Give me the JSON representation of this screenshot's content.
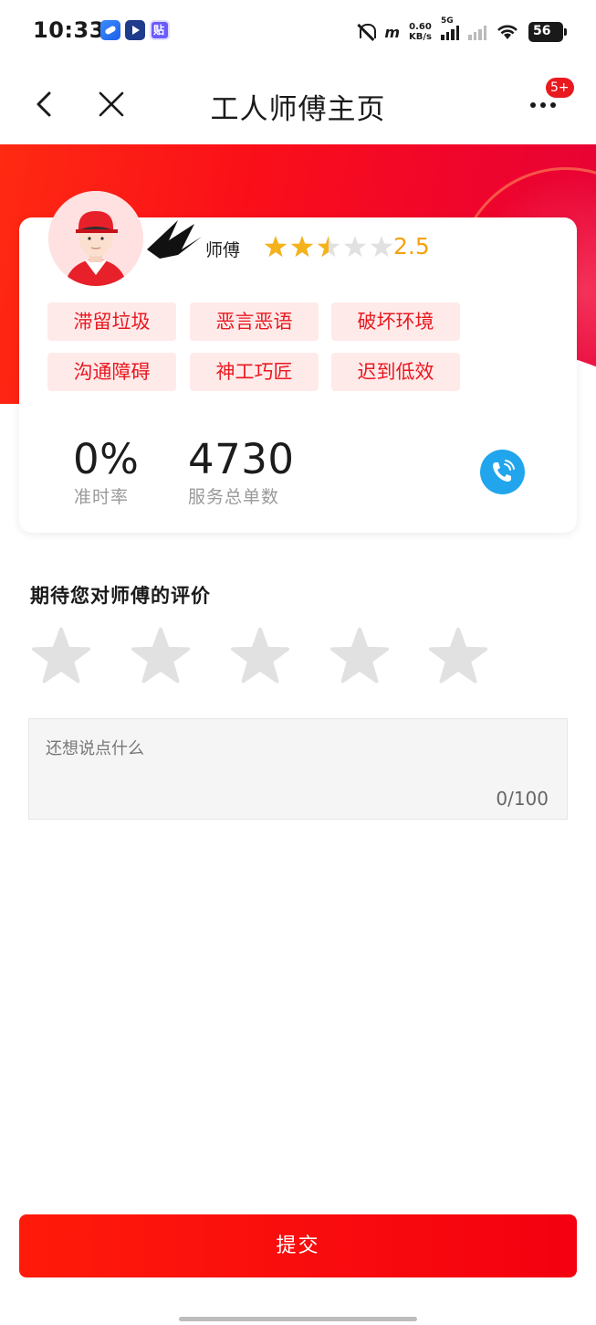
{
  "status_bar": {
    "time": "10:33",
    "app_icons": [
      "blue-app-icon",
      "video-app-icon",
      "sticker-app-icon"
    ],
    "app_icon_text": "贴",
    "mute_icon": "bell-off-icon",
    "carrier_badge": "m",
    "net_speed_value": "0.60",
    "net_speed_unit": "KB/s",
    "network_type": "5G",
    "battery": "56"
  },
  "nav": {
    "title": "工人师傅主页",
    "back_icon": "chevron-left-icon",
    "close_icon": "close-icon",
    "more_icon": "more-dots-icon",
    "badge": "5+"
  },
  "worker": {
    "name_suffix": "师傅",
    "rating": "2.5",
    "rating_value": 2.5,
    "rating_max": 5,
    "tags": [
      "滞留垃圾",
      "恶言恶语",
      "破坏环境",
      "沟通障碍",
      "神工巧匠",
      "迟到低效"
    ],
    "stats": [
      {
        "value": "0%",
        "label": "准时率"
      },
      {
        "value": "4730",
        "label": "服务总单数"
      }
    ],
    "call_icon": "phone-icon"
  },
  "review": {
    "title": "期待您对师傅的评价",
    "selected_stars": 0,
    "comment_placeholder": "还想说点什么",
    "comment_value": "",
    "char_count": "0/100"
  },
  "actions": {
    "submit_label": "提交"
  },
  "colors": {
    "brand_red": "#f40010",
    "tag_bg": "#ffeaea",
    "star_gold": "#f5b21b",
    "star_gray": "#e1e1e1",
    "call_blue": "#21a5ec"
  }
}
